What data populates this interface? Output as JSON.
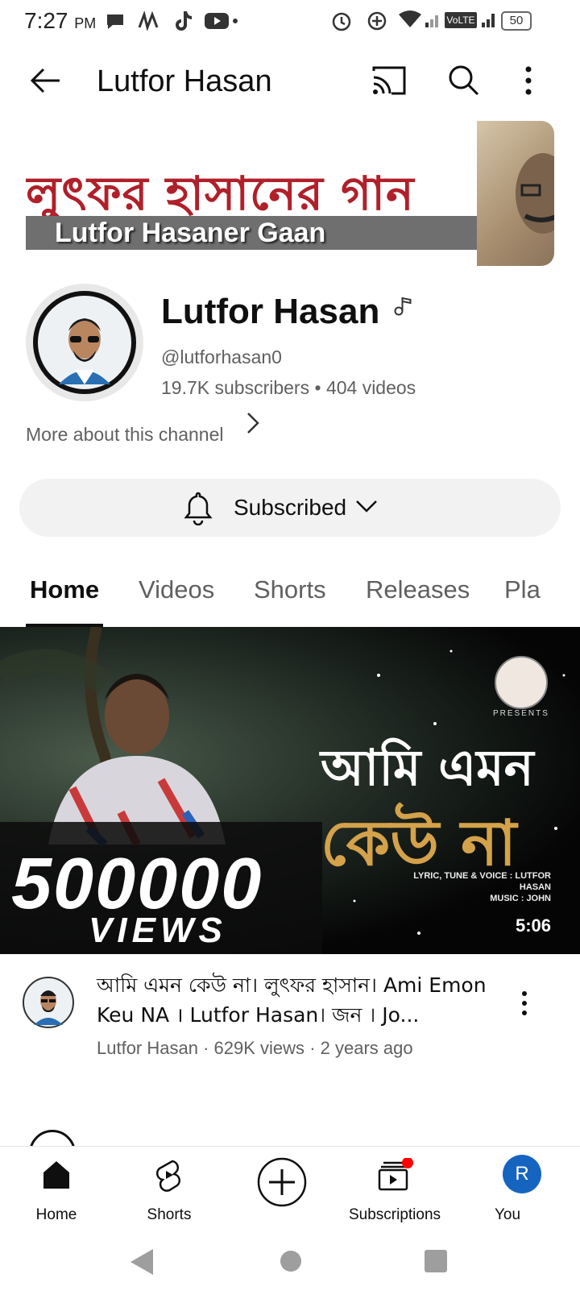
{
  "status_bar": {
    "time": "7:27",
    "ampm": "PM",
    "network_label": "VoLTE",
    "battery": "50"
  },
  "app_bar": {
    "title": "Lutfor Hasan",
    "icons": [
      "back-arrow-icon",
      "cast-icon",
      "search-icon",
      "more-vert-icon"
    ]
  },
  "banner": {
    "bengali_text": "লুৎফর হাসানের গান",
    "english_text": "Lutfor Hasaner Gaan"
  },
  "channel": {
    "name": "Lutfor Hasan",
    "handle": "@lutforhasan0",
    "subscribers": "19.7K subscribers",
    "separator": "•",
    "videos": "404 videos",
    "more_about": "More about this channel",
    "subscribe_state": "Subscribed"
  },
  "tabs": [
    "Home",
    "Videos",
    "Shorts",
    "Releases",
    "Pla"
  ],
  "active_tab": "Home",
  "featured_video": {
    "thumbnail": {
      "big_number": "500000",
      "views_word": "VIEWS",
      "bengali_line1": "আমি এমন",
      "bengali_line2": "কেউ না",
      "presents": "PRESENTS",
      "credits_line1": "LYRIC, TUNE & VOICE : LUTFOR HASAN",
      "credits_line2": "MUSIC : JOHN"
    },
    "duration": "5:06",
    "title": "আমি এমন কেউ না। লুৎফর হাসান। Ami Emon Keu NA । Lutfor Hasan। জন । Jo...",
    "channel": "Lutfor Hasan",
    "views": "629K views",
    "age": "2 years ago",
    "meta_sep": "·"
  },
  "bottom_nav": {
    "items": [
      {
        "label": "Home",
        "icon": "home-icon"
      },
      {
        "label": "Shorts",
        "icon": "shorts-icon"
      },
      {
        "label": "",
        "icon": "create-plus-icon"
      },
      {
        "label": "Subscriptions",
        "icon": "subscriptions-icon"
      },
      {
        "label": "You",
        "icon": "avatar"
      }
    ],
    "you_initial": "R"
  },
  "colors": {
    "accent_red": "#ff0000",
    "you_avatar": "#1565c0",
    "banner_red": "#b0202a",
    "thumb_gold": "#d4a24a"
  }
}
